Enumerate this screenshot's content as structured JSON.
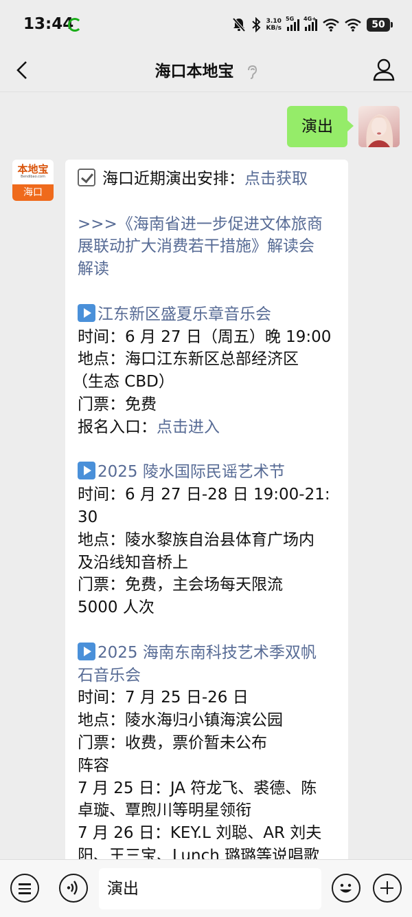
{
  "status_bar": {
    "time": "13:44",
    "speed_value": "3.10",
    "speed_unit": "KB/s",
    "net1": "5G",
    "net2": "4G+",
    "battery": "50"
  },
  "nav": {
    "title": "海口本地宝"
  },
  "messages": {
    "user_message": "演出",
    "bot_avatar": {
      "logo_text": "本地宝",
      "logo_domain": "Bendibao.com",
      "city": "海口"
    },
    "bot_reply": {
      "header_text": "海口近期演出安排：",
      "header_link": "点击获取",
      "intro_line1": ">>>《海南省进一步促进文体旅商",
      "intro_line2": "展联动扩大消费若干措施》解读会",
      "intro_line3": "解读",
      "event1_title": "江东新区盛夏乐章音乐会",
      "event1_time": "时间：6 月 27 日（周五）晚 19:00",
      "event1_place1": "地点：海口江东新区总部经济区",
      "event1_place2": "（生态 CBD）",
      "event1_ticket": "门票：免费",
      "event1_signup_label": "报名入口：",
      "event1_signup_link": "点击进入",
      "event2_title": "2025 陵水国际民谣艺术节",
      "event2_time1": "时间：6 月 27 日-28 日 19:00-21:",
      "event2_time2": "30",
      "event2_place1": "地点：陵水黎族自治县体育广场内",
      "event2_place2": "及沿线知音桥上",
      "event2_ticket1": "门票：免费，主会场每天限流",
      "event2_ticket2": "5000 人次",
      "event3_title1": "2025 海南东南科技艺术季双帆",
      "event3_title2": "石音乐会",
      "event3_time": "时间：7 月 25 日-26 日",
      "event3_place": "地点：陵水海归小镇海滨公园",
      "event3_ticket": "门票：收费，票价暂未公布",
      "event3_lineup": "阵容",
      "event3_day1_line1": "7 月 25 日：JA 符龙飞、裘德、陈",
      "event3_day1_line2": "卓璇、覃煦川等明星领衔",
      "event3_day2_line1": "7 月 26 日：KEY.L 刘聪、AR 刘夫",
      "event3_day2_line2": "阳、王三宝、Lunch 璐璐等说唱歌"
    }
  },
  "input_bar": {
    "input_value": "演出"
  }
}
